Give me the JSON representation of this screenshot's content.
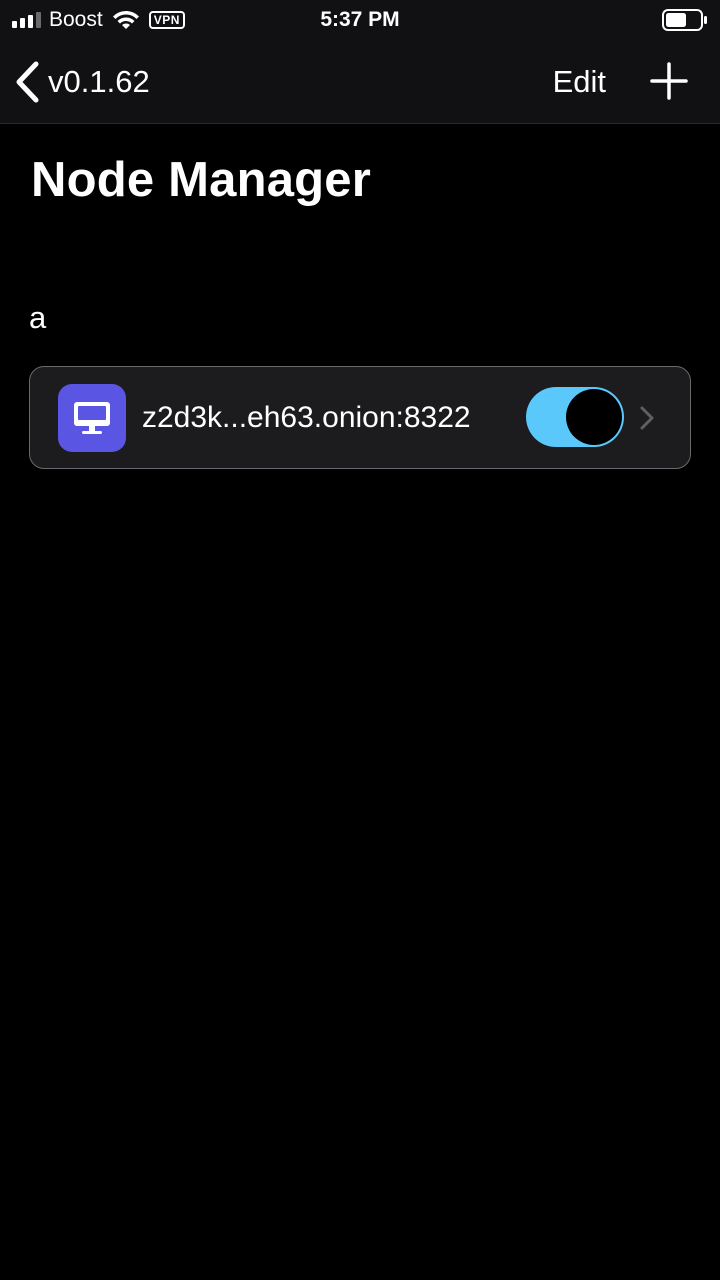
{
  "status_bar": {
    "carrier": "Boost",
    "vpn": "VPN",
    "time": "5:37 PM"
  },
  "nav": {
    "back_label": "v0.1.62",
    "edit_label": "Edit"
  },
  "page_title": "Node Manager",
  "sections": [
    {
      "header": "a",
      "nodes": [
        {
          "address": "z2d3k...eh63.onion:8322",
          "enabled": true,
          "icon": "desktop-icon"
        }
      ]
    }
  ],
  "colors": {
    "nav_background": "#111114",
    "icon_background": "#5a55e3",
    "toggle_on": "#5ac8fa",
    "row_background": "#1c1c1e"
  }
}
